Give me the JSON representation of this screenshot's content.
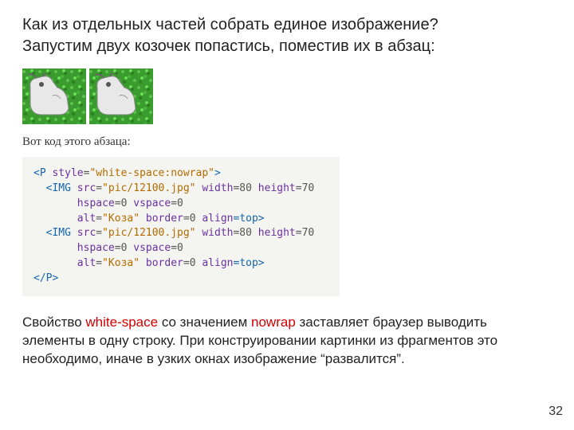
{
  "heading_line1": "Как из отдельных частей собрать единое изображение?",
  "heading_line2": "Запустим двух козочек попастись, поместив их в абзац:",
  "caption": "Вот код этого абзаца:",
  "code": {
    "l1a": "<P ",
    "l1b": "style",
    "l1c": "=",
    "l1d": "\"white-space:nowrap\"",
    "l1e": ">",
    "l2a": "  <IMG ",
    "l2b": "src",
    "l2c": "=",
    "l2d": "\"pic/12100.jpg\"",
    "l2e": " width",
    "l2f": "=80 ",
    "l2g": "height",
    "l2h": "=70",
    "l3a": "       ",
    "l3b": "hspace",
    "l3c": "=0 ",
    "l3d": "vspace",
    "l3e": "=0",
    "l4a": "       ",
    "l4b": "alt",
    "l4c": "=",
    "l4d": "\"Коза\"",
    "l4e": " border",
    "l4f": "=0 ",
    "l4g": "align",
    "l4h": "=top>",
    "l5a": "  <IMG ",
    "l5b": "src",
    "l5c": "=",
    "l5d": "\"pic/12100.jpg\"",
    "l5e": " width",
    "l5f": "=80 ",
    "l5g": "height",
    "l5h": "=70",
    "l6a": "       ",
    "l6b": "hspace",
    "l6c": "=0 ",
    "l6d": "vspace",
    "l6e": "=0",
    "l7a": "       ",
    "l7b": "alt",
    "l7c": "=",
    "l7d": "\"Коза\"",
    "l7e": " border",
    "l7f": "=0 ",
    "l7g": "align",
    "l7h": "=top>",
    "l8": "</P>"
  },
  "para": {
    "t1": "Свойство ",
    "kw1": "white-space",
    "t2": " со значением ",
    "kw2": "nowrap",
    "t3": " заставляет браузер выводить элементы в одну строку. При конструировании картинки из фрагментов это необходимо, иначе в узких окнах изображение “развалится”."
  },
  "page_number": "32"
}
